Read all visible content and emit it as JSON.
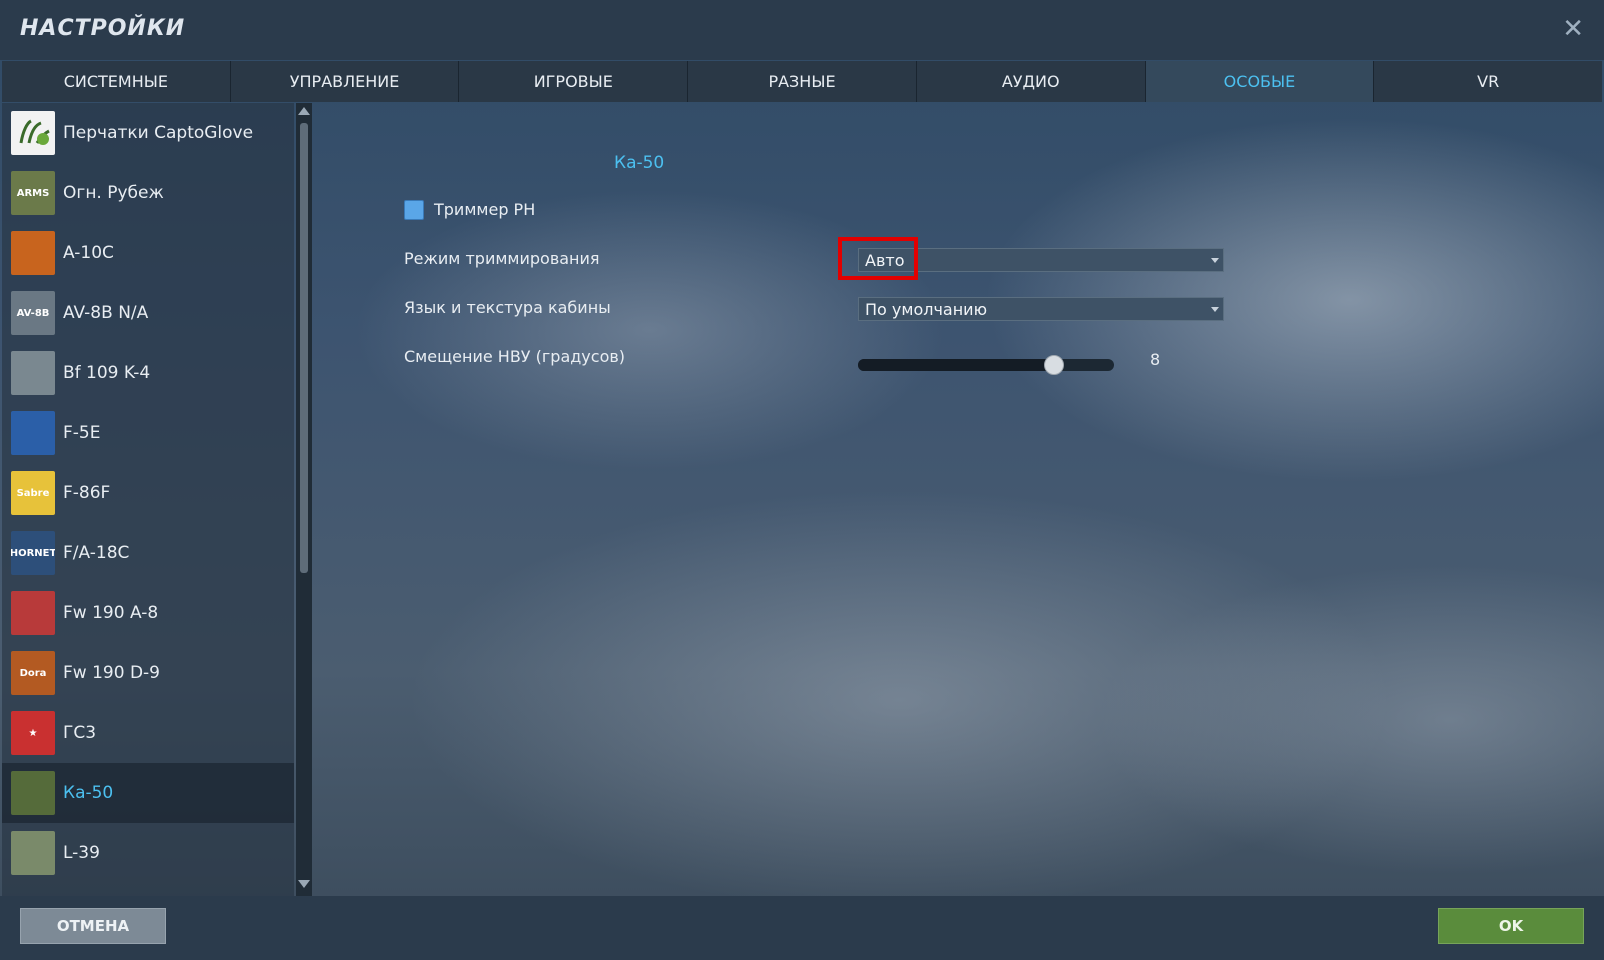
{
  "window": {
    "title": "НАСТРОЙКИ",
    "close_glyph": "✕"
  },
  "tabs": [
    {
      "label": "СИСТЕМНЫЕ"
    },
    {
      "label": "УПРАВЛЕНИЕ"
    },
    {
      "label": "ИГРОВЫЕ"
    },
    {
      "label": "РАЗНЫЕ"
    },
    {
      "label": "АУДИО"
    },
    {
      "label": "ОСОБЫЕ",
      "active": true
    },
    {
      "label": "VR"
    }
  ],
  "sidebar": {
    "items": [
      {
        "label": "Перчатки CaptoGlove",
        "icon": "glove-icon",
        "color": "#f2f2f2",
        "glyph": ""
      },
      {
        "label": "Огн. Рубеж",
        "icon": "combined-arms-icon",
        "color": "#6b7a4a",
        "glyph": "ARMS"
      },
      {
        "label": "A-10C",
        "icon": "a10c-icon",
        "color": "#c8641e",
        "glyph": ""
      },
      {
        "label": "AV-8B N/A",
        "icon": "av8b-icon",
        "color": "#6a7884",
        "glyph": "AV-8B"
      },
      {
        "label": "Bf 109 K-4",
        "icon": "bf109-icon",
        "color": "#7a8890",
        "glyph": ""
      },
      {
        "label": "F-5E",
        "icon": "f5e-icon",
        "color": "#2b5fa8",
        "glyph": ""
      },
      {
        "label": "F-86F",
        "icon": "f86f-icon",
        "color": "#e7c23a",
        "glyph": "Sabre"
      },
      {
        "label": "F/A-18C",
        "icon": "fa18c-icon",
        "color": "#2d4f7a",
        "glyph": "HORNET"
      },
      {
        "label": "Fw 190 A-8",
        "icon": "fw190a8-icon",
        "color": "#b83a3a",
        "glyph": ""
      },
      {
        "label": "Fw 190 D-9",
        "icon": "fw190d9-icon",
        "color": "#b35a22",
        "glyph": "Dora"
      },
      {
        "label": "ГС3",
        "icon": "gs3-icon",
        "color": "#c93030",
        "glyph": "★"
      },
      {
        "label": "Ка-50",
        "icon": "ka50-icon",
        "color": "#556b3a",
        "glyph": "",
        "active": true
      },
      {
        "label": "L-39",
        "icon": "l39-icon",
        "color": "#7a8a6a",
        "glyph": ""
      }
    ]
  },
  "content": {
    "section_title": "Ка-50",
    "checkbox": {
      "label": "Триммер РН",
      "checked": true
    },
    "trim_mode": {
      "label": "Режим триммирования",
      "value": "Авто"
    },
    "cockpit_lang": {
      "label": "Язык и текстура кабины",
      "value": "По умолчанию"
    },
    "hud_offset": {
      "label": "Смещение НВУ (градусов)",
      "value": "8",
      "fraction": 0.76
    }
  },
  "footer": {
    "cancel_label": "ОТМЕНА",
    "ok_label": "OK"
  },
  "colors": {
    "accent": "#4cc0f0",
    "ok": "#5a8c3c",
    "cancel": "#7d8a96",
    "highlight": "#e30000"
  }
}
